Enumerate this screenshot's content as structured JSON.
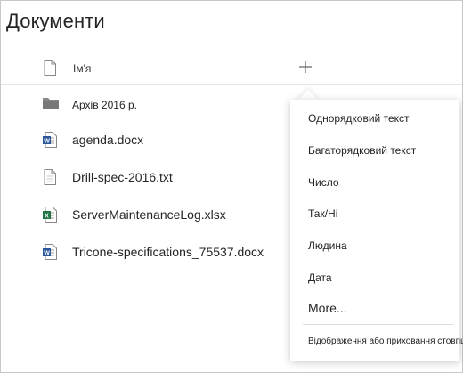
{
  "page": {
    "title": "Документи"
  },
  "header": {
    "name_column": "Ім'я",
    "add_column_label": "+"
  },
  "files": [
    {
      "name": "Архів 2016 р.",
      "icon": "folder-icon",
      "type": "folder"
    },
    {
      "name": "agenda.docx",
      "icon": "word-doc-icon",
      "type": "docx"
    },
    {
      "name": "Drill-spec-2016.txt",
      "icon": "text-file-icon",
      "type": "txt"
    },
    {
      "name": "ServerMaintenanceLog.xlsx",
      "icon": "excel-doc-icon",
      "type": "xlsx"
    },
    {
      "name": "Tricone-specifications_75537.docx",
      "icon": "word-doc-icon",
      "type": "docx"
    }
  ],
  "menu": {
    "items": [
      {
        "label": "Однорядковий текст"
      },
      {
        "label": "Багаторядковий текст"
      },
      {
        "label": "Число"
      },
      {
        "label": "Так/Ні"
      },
      {
        "label": "Людина"
      },
      {
        "label": "Дата"
      }
    ],
    "more_label": "More...",
    "footer_label": "Відображення або приховання стовпців"
  },
  "colors": {
    "word_blue": "#2b579a",
    "excel_green": "#217346",
    "folder_gray": "#8a8886",
    "border": "#c8c8c8"
  }
}
